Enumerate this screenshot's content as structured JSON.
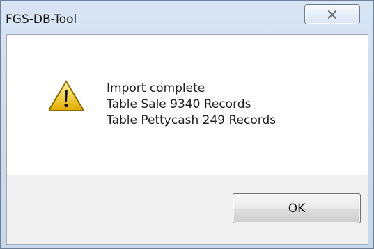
{
  "window": {
    "title": "FGS-DB-Tool",
    "close_button": {
      "icon": "close-icon",
      "symbol": "✕"
    }
  },
  "dialog": {
    "icon": "warning-icon",
    "message_lines": [
      "Import complete",
      "Table Sale 9340 Records",
      "Table Pettycash 249 Records"
    ],
    "buttons": {
      "ok": "OK"
    }
  },
  "colors": {
    "frame_background": "#c9d8ec",
    "content_background": "#ffffff",
    "button_panel_background": "#f0f0f0",
    "warning_fill": "#f3cf2a",
    "warning_outline": "#8d6c00",
    "text_color": "#1f1f1f"
  }
}
